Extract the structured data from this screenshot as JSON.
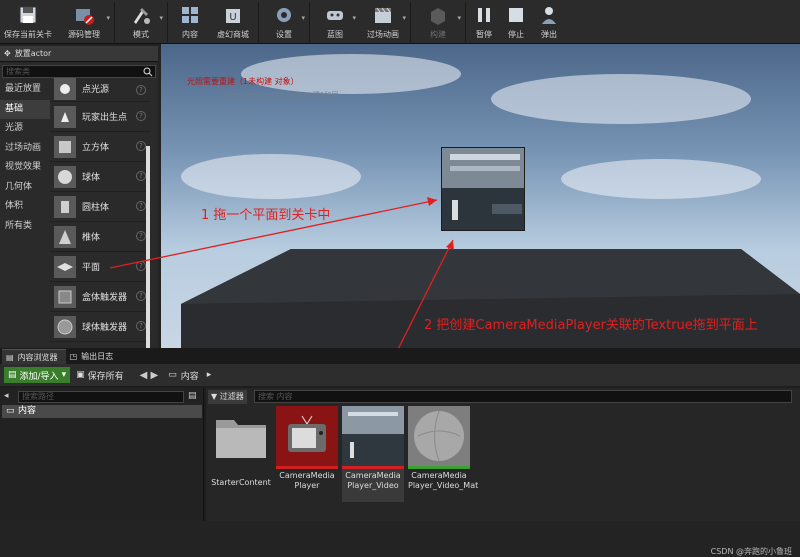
{
  "toolbar": {
    "items": [
      {
        "label": "保存当前关卡",
        "icon": "save-icon"
      },
      {
        "label": "源码管理",
        "icon": "source-control-icon"
      },
      {
        "label": "模式",
        "icon": "modes-icon"
      },
      {
        "label": "内容",
        "icon": "content-icon"
      },
      {
        "label": "虚幻商城",
        "icon": "marketplace-icon"
      },
      {
        "label": "设置",
        "icon": "settings-icon"
      },
      {
        "label": "蓝图",
        "icon": "blueprint-icon"
      },
      {
        "label": "过场动画",
        "icon": "cinematics-icon"
      },
      {
        "label": "构建",
        "icon": "build-icon"
      },
      {
        "label": "暂停",
        "icon": "pause-icon"
      },
      {
        "label": "停止",
        "icon": "stop-icon"
      },
      {
        "label": "弹出",
        "icon": "eject-icon"
      }
    ]
  },
  "place_panel": {
    "tab_label": "放置actor",
    "search_placeholder": "搜索类",
    "categories": [
      "最近放置",
      "基础",
      "光源",
      "过场动画",
      "视觉效果",
      "几何体",
      "体积",
      "所有类"
    ],
    "selected_category": "基础",
    "items": [
      "点光源",
      "玩家出生点",
      "立方体",
      "球体",
      "圆柱体",
      "椎体",
      "平面",
      "盒体触发器",
      "球体触发器"
    ]
  },
  "viewport": {
    "warning": "光照需要重建（1未构建 对象）",
    "sub_warning": "SceneCaptureComponent 建1f0同",
    "annotation_1": "1 拖一个平面到关卡中",
    "annotation_2": "2 把创建CameraMediaPlayer关联的Textrue拖到平面上"
  },
  "bottom": {
    "tabs": [
      "内容浏览器",
      "输出日志"
    ],
    "add_import": "添加/导入",
    "save_all": "保存所有",
    "breadcrumb": "内容",
    "path_search_placeholder": "搜索路径",
    "tree_root": "内容",
    "filter_label": "过滤器",
    "asset_search_placeholder": "搜索 内容",
    "assets": [
      {
        "name": "StarterContent",
        "type": "folder"
      },
      {
        "name": "CameraMedia Player",
        "type": "media-player"
      },
      {
        "name": "CameraMedia Player_Video",
        "type": "media-texture"
      },
      {
        "name": "CameraMedia Player_Video_Mat",
        "type": "material"
      }
    ]
  },
  "watermark": "CSDN @奔跑的小鲁班",
  "colors": {
    "accent_green": "#3a7d2a",
    "annotation_red": "#e02020",
    "media_player_red": "#a01818"
  }
}
